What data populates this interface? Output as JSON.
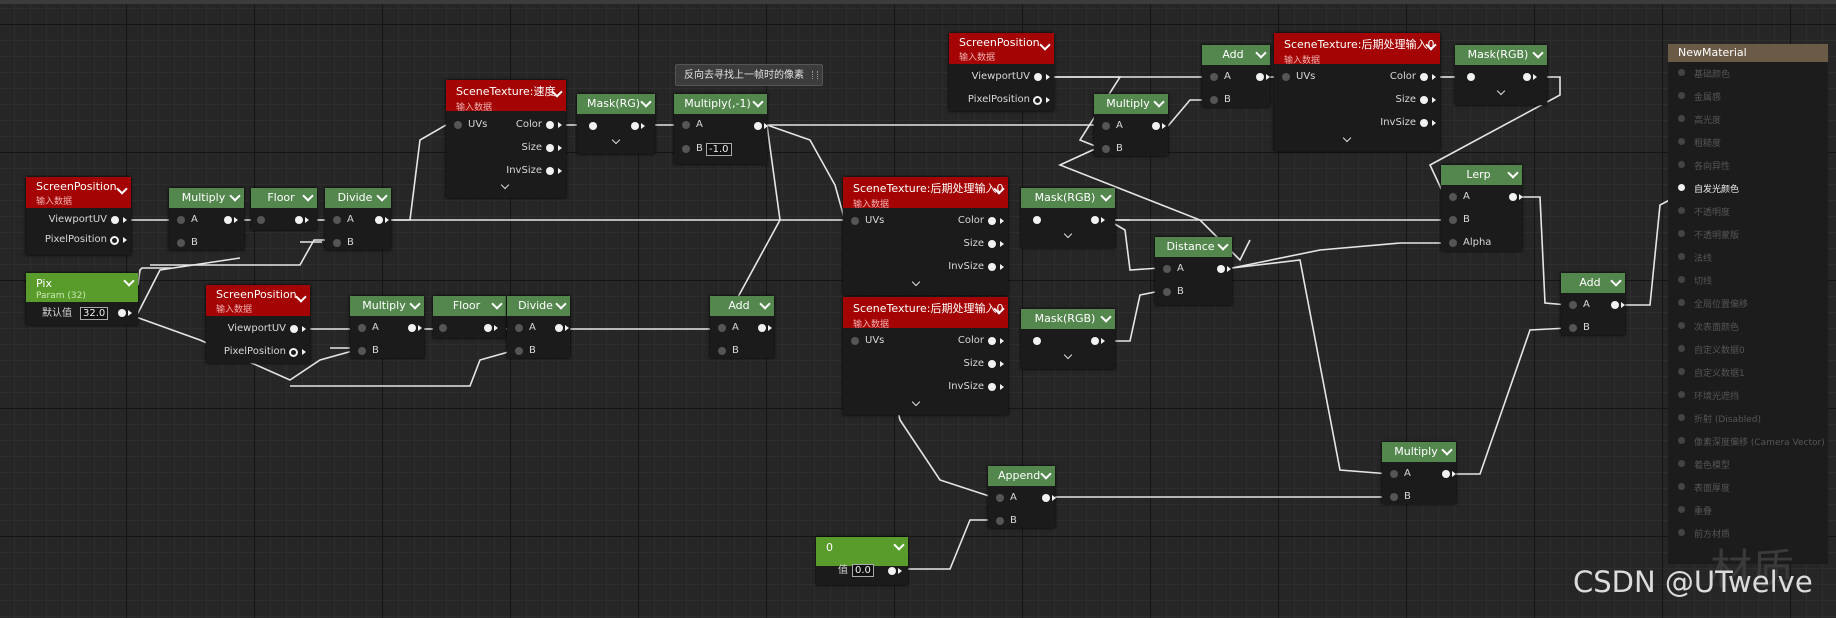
{
  "tooltip": "反向去寻找上一帧时的像素",
  "nodes": {
    "sp1": {
      "title": "ScreenPosition",
      "subtitle": "输入数据",
      "pins": [
        "ViewportUV",
        "PixelPosition"
      ]
    },
    "pix": {
      "title": "Pix",
      "subtitle": "Param (32)",
      "label": "默认值",
      "value": "32.0"
    },
    "mul1": {
      "title": "Multiply",
      "pins": [
        "A",
        "B"
      ]
    },
    "floor1": {
      "title": "Floor"
    },
    "div1": {
      "title": "Divide",
      "pins": [
        "A",
        "B"
      ]
    },
    "sp2": {
      "title": "ScreenPosition",
      "subtitle": "输入数据",
      "pins": [
        "ViewportUV",
        "PixelPosition"
      ]
    },
    "mul2": {
      "title": "Multiply",
      "pins": [
        "A",
        "B"
      ]
    },
    "floor2": {
      "title": "Floor"
    },
    "div2": {
      "title": "Divide",
      "pins": [
        "A",
        "B"
      ]
    },
    "stv": {
      "title": "SceneTexture:速度",
      "subtitle": "输入数据",
      "pins": [
        "UVs",
        "Color",
        "Size",
        "InvSize"
      ]
    },
    "maskrg": {
      "title": "Mask(RG)"
    },
    "mulneg": {
      "title": "Multiply(,-1)",
      "pins": [
        "A",
        "B"
      ],
      "b_value": "-1.0"
    },
    "add2": {
      "title": "Add",
      "pins": [
        "A",
        "B"
      ]
    },
    "sp3": {
      "title": "ScreenPosition",
      "subtitle": "输入数据",
      "pins": [
        "ViewportUV",
        "PixelPosition"
      ]
    },
    "add1": {
      "title": "Add",
      "pins": [
        "A",
        "B"
      ]
    },
    "mul3": {
      "title": "Multiply",
      "pins": [
        "A",
        "B"
      ]
    },
    "st1": {
      "title": "SceneTexture:后期处理输入0",
      "subtitle": "输入数据",
      "pins": [
        "UVs",
        "Color",
        "Size",
        "InvSize"
      ]
    },
    "maskrgb1": {
      "title": "Mask(RGB)"
    },
    "st2": {
      "title": "SceneTexture:后期处理输入0",
      "subtitle": "输入数据",
      "pins": [
        "UVs",
        "Color",
        "Size",
        "InvSize"
      ]
    },
    "maskrgb2": {
      "title": "Mask(RGB)"
    },
    "st3": {
      "title": "SceneTexture:后期处理输入0",
      "subtitle": "输入数据",
      "pins": [
        "UVs",
        "Color",
        "Size",
        "InvSize"
      ]
    },
    "maskrgb3": {
      "title": "Mask(RGB)"
    },
    "distance": {
      "title": "Distance",
      "pins": [
        "A",
        "B"
      ]
    },
    "lerp": {
      "title": "Lerp",
      "pins": [
        "A",
        "B",
        "Alpha"
      ]
    },
    "add3": {
      "title": "Add",
      "pins": [
        "A",
        "B"
      ]
    },
    "mul4": {
      "title": "Multiply",
      "pins": [
        "A",
        "B"
      ]
    },
    "append": {
      "title": "Append",
      "pins": [
        "A",
        "B"
      ]
    },
    "const0": {
      "title": "0",
      "label": "值",
      "value": "0.0"
    }
  },
  "result": {
    "title": "NewMaterial",
    "pins": [
      "基础颜色",
      "金属感",
      "高光度",
      "粗糙度",
      "各向异性",
      "自发光颜色",
      "不透明度",
      "不透明蒙版",
      "法线",
      "切线",
      "全局位置偏移",
      "次表面颜色",
      "自定义数据0",
      "自定义数据1",
      "环境光遮挡",
      "折射 (Disabled)",
      "像素深度偏移 (Camera Vector)",
      "着色模型",
      "表面厚度",
      "重叠",
      "前方材质"
    ],
    "active_pin": "自发光颜色"
  },
  "watermark": "CSDN @UTwelve",
  "watermark_bg": "材质",
  "colors": {
    "red_header": "#a40404",
    "green_header": "#54874e",
    "param_header": "#5a9c2c",
    "result_header": "#6b5a45",
    "grid": "#262626"
  }
}
